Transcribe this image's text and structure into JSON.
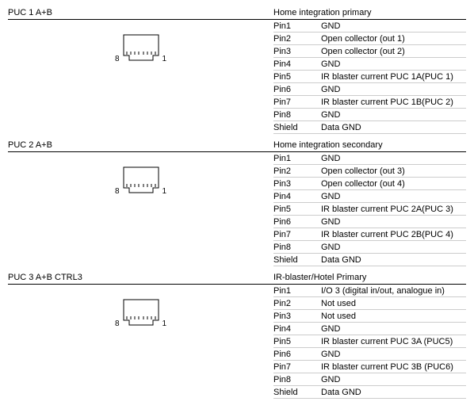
{
  "sections": [
    {
      "title": "PUC 1 A+B",
      "subtitle": "Home integration primary",
      "connector": {
        "left_label": "8",
        "right_label": "1"
      },
      "pins": [
        {
          "name": "Pin1",
          "desc": "GND"
        },
        {
          "name": "Pin2",
          "desc": "Open collector (out 1)"
        },
        {
          "name": "Pin3",
          "desc": "Open collector (out 2)"
        },
        {
          "name": "Pin4",
          "desc": "GND"
        },
        {
          "name": "Pin5",
          "desc": "IR blaster current PUC 1A(PUC 1)"
        },
        {
          "name": "Pin6",
          "desc": "GND"
        },
        {
          "name": "Pin7",
          "desc": "IR blaster current PUC 1B(PUC 2)"
        },
        {
          "name": "Pin8",
          "desc": "GND"
        },
        {
          "name": "Shield",
          "desc": "Data GND"
        }
      ]
    },
    {
      "title": "PUC 2 A+B",
      "subtitle": "Home integration secondary",
      "connector": {
        "left_label": "8",
        "right_label": "1"
      },
      "pins": [
        {
          "name": "Pin1",
          "desc": "GND"
        },
        {
          "name": "Pin2",
          "desc": "Open collector (out 3)"
        },
        {
          "name": "Pin3",
          "desc": "Open collector (out 4)"
        },
        {
          "name": "Pin4",
          "desc": "GND"
        },
        {
          "name": "Pin5",
          "desc": "IR blaster current PUC 2A(PUC 3)"
        },
        {
          "name": "Pin6",
          "desc": "GND"
        },
        {
          "name": "Pin7",
          "desc": "IR blaster current PUC 2B(PUC 4)"
        },
        {
          "name": "Pin8",
          "desc": "GND"
        },
        {
          "name": "Shield",
          "desc": "Data GND"
        }
      ]
    },
    {
      "title": "PUC 3 A+B CTRL3",
      "subtitle": "IR-blaster/Hotel Primary",
      "connector": {
        "left_label": "8",
        "right_label": "1"
      },
      "pins": [
        {
          "name": "Pin1",
          "desc": "I/O 3 (digital in/out, analogue in)"
        },
        {
          "name": "Pin2",
          "desc": "Not used"
        },
        {
          "name": "Pin3",
          "desc": "Not used"
        },
        {
          "name": "Pin4",
          "desc": "GND"
        },
        {
          "name": "Pin5",
          "desc": "IR blaster current PUC 3A (PUC5)"
        },
        {
          "name": "Pin6",
          "desc": "GND"
        },
        {
          "name": "Pin7",
          "desc": "IR blaster current PUC 3B (PUC6)"
        },
        {
          "name": "Pin8",
          "desc": "GND"
        },
        {
          "name": "Shield",
          "desc": "Data GND"
        }
      ]
    }
  ]
}
